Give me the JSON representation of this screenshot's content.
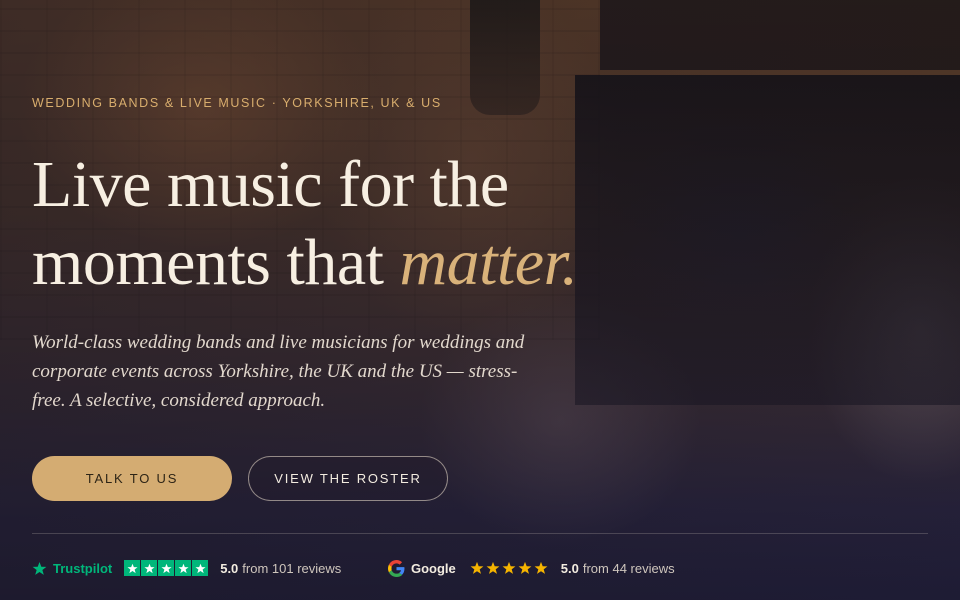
{
  "hero": {
    "eyebrow": "WEDDING BANDS & LIVE MUSIC · YORKSHIRE, UK & US",
    "headline_line1": "Live music for the",
    "headline_line2": "moments that ",
    "headline_accent": "matter.",
    "subhead": "World-class wedding bands and live musicians for weddings and corporate events across Yorkshire, the UK and the US — stress-free. A selective, considered approach."
  },
  "buttons": {
    "primary": "TALK TO US",
    "secondary": "VIEW THE ROSTER"
  },
  "reviews": {
    "trustpilot": {
      "name": "Trustpilot",
      "score": "5.0",
      "count_text": "from 101 reviews",
      "stars": 5,
      "color": "#00b67a"
    },
    "google": {
      "name": "Google",
      "score": "5.0",
      "count_text": "from 44 reviews",
      "stars": 5,
      "star_color": "#f5b400"
    }
  },
  "colors": {
    "accent_gold": "#d4ac72",
    "text_light": "#f7efe2",
    "eyebrow": "#d8ad6d"
  },
  "icons": [
    "trustpilot-star-icon",
    "star-icon",
    "google-logo-icon"
  ]
}
